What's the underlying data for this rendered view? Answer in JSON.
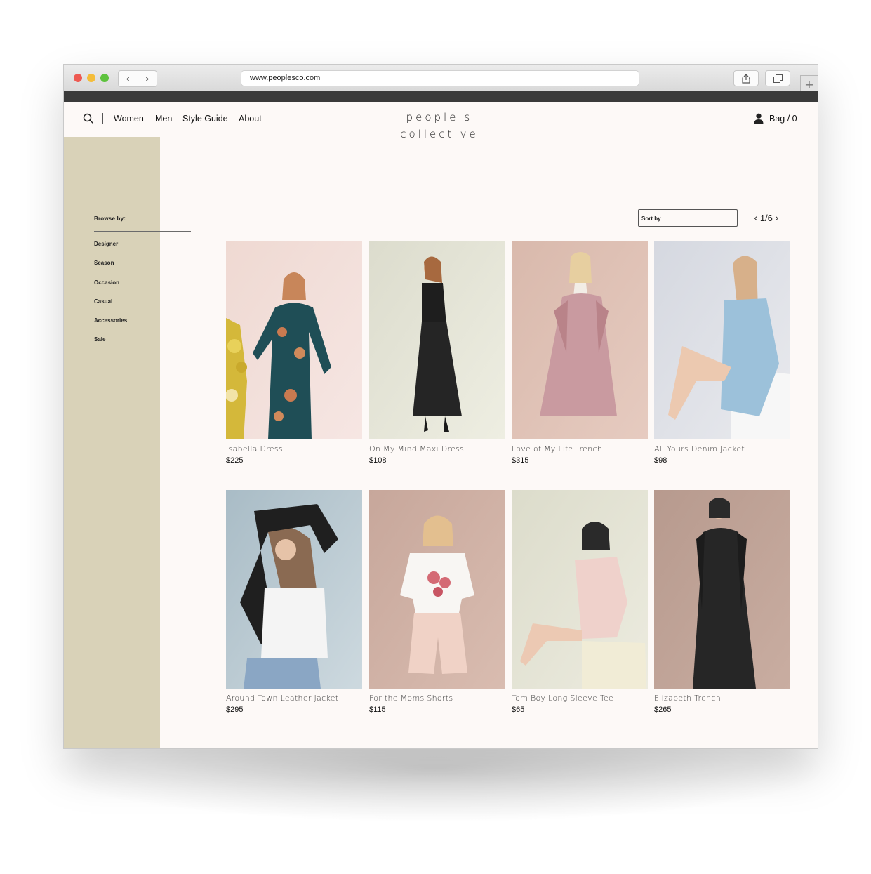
{
  "browser": {
    "url": "www.peoplesco.com"
  },
  "header": {
    "nav": [
      "Women",
      "Men",
      "Style Guide",
      "About"
    ],
    "logo_line1": "people's",
    "logo_line2": "collective",
    "bag_label": "Bag / 0"
  },
  "sidebar": {
    "title": "Browse by:",
    "items": [
      "Designer",
      "Season",
      "Occasion",
      "Casual",
      "Accessories",
      "Sale"
    ]
  },
  "controls": {
    "sort_label": "Sort by",
    "page_current": "1/6"
  },
  "products": [
    {
      "name": "Isabella Dress",
      "price": "$225"
    },
    {
      "name": "On My Mind Maxi Dress",
      "price": "$108"
    },
    {
      "name": "Love of My Life Trench",
      "price": "$315"
    },
    {
      "name": "All Yours Denim Jacket",
      "price": "$98"
    },
    {
      "name": "Around Town Leather Jacket",
      "price": "$295"
    },
    {
      "name": "For the Moms Shorts",
      "price": "$115"
    },
    {
      "name": "Tom Boy Long Sleeve Tee",
      "price": "$65"
    },
    {
      "name": "Elizabeth Trench",
      "price": "$265"
    }
  ],
  "icons": {
    "search": "search-icon",
    "user": "user-icon",
    "share": "share-icon",
    "tabs": "tabs-icon",
    "new_tab": "plus-icon"
  },
  "colors": {
    "page_background": "#fdf9f7",
    "sidebar": "#d9d2b8",
    "window_chrome_bar": "#3a3a3a"
  }
}
